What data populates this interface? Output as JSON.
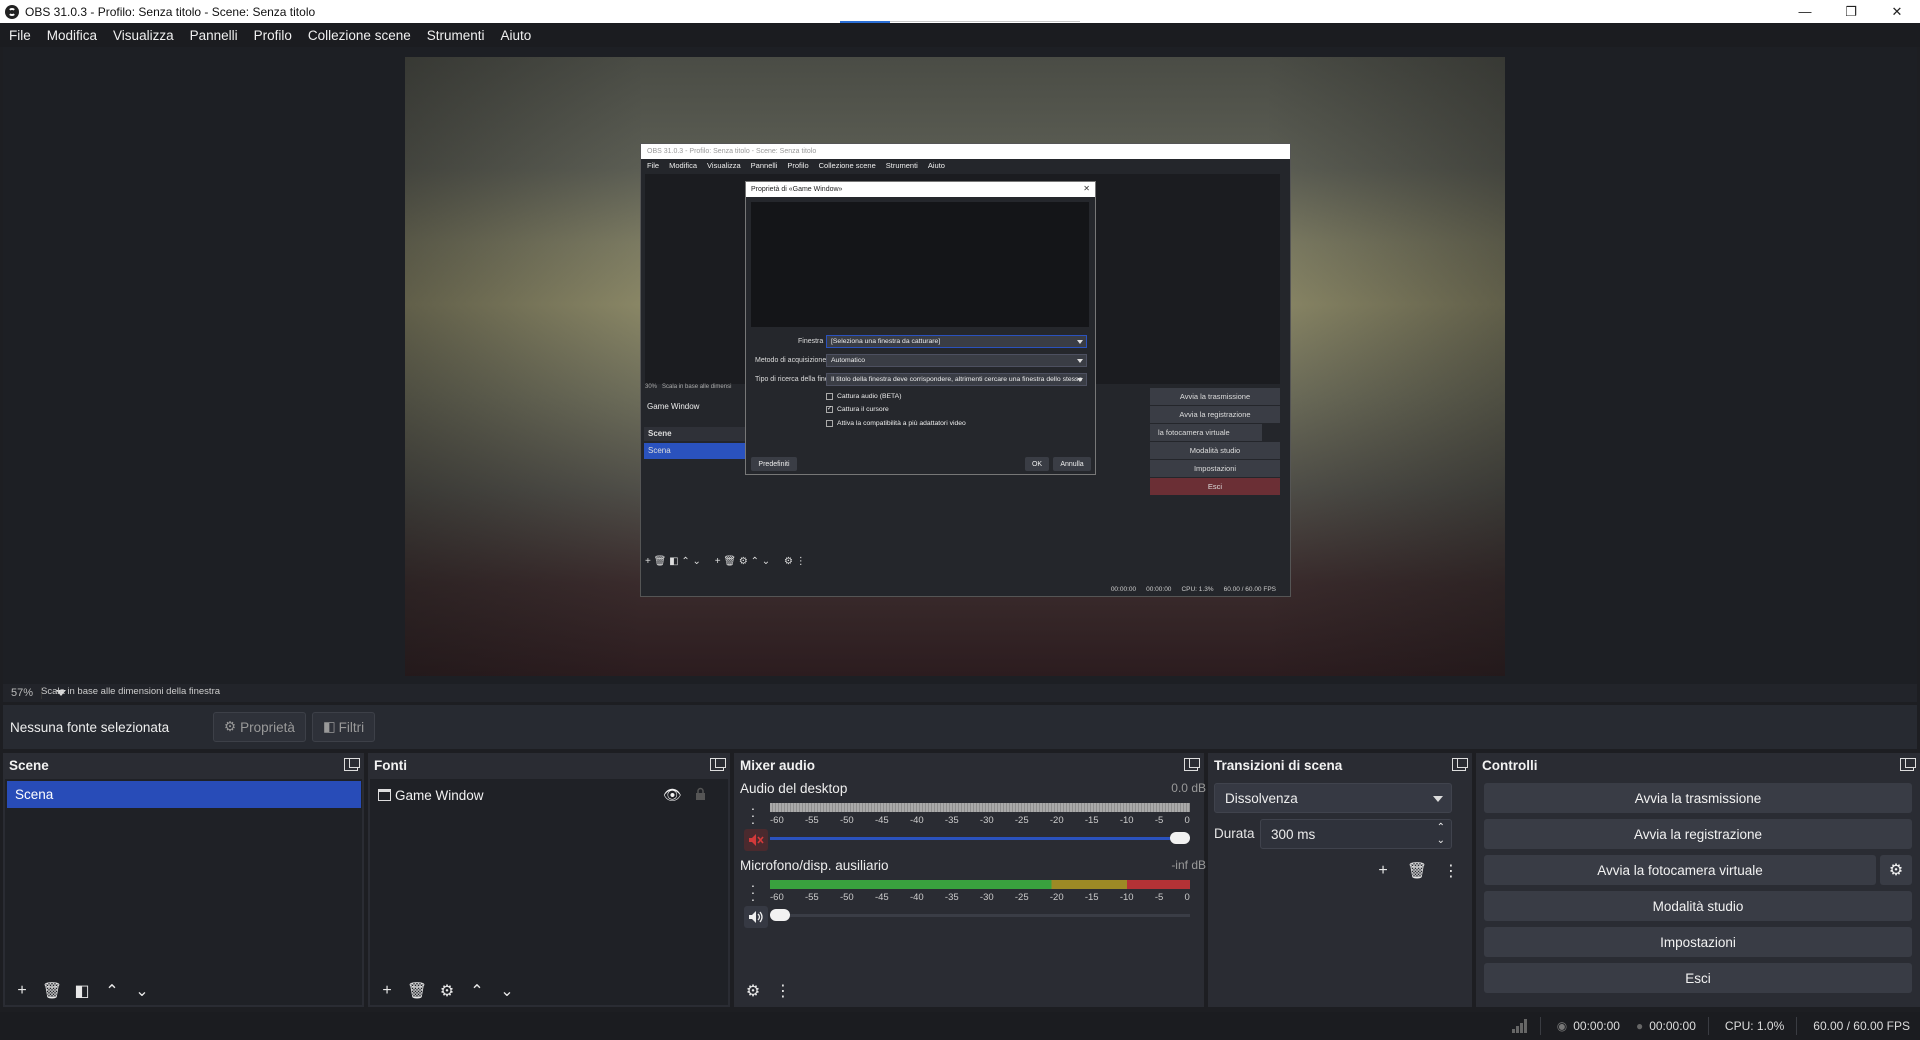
{
  "window": {
    "title": "OBS 31.0.3 - Profilo: Senza titolo - Scene: Senza titolo",
    "minimize": "—",
    "restore": "❐",
    "close": "✕"
  },
  "menu": [
    "File",
    "Modifica",
    "Visualizza",
    "Pannelli",
    "Profilo",
    "Collezione scene",
    "Strumenti",
    "Aiuto"
  ],
  "preview": {
    "zoom": "57%",
    "scale_mode": "Scala in base alle dimensioni della finestra",
    "nested": {
      "title": "OBS 31.0.3 - Profilo: Senza titolo - Scene: Senza titolo",
      "menu": [
        "File",
        "Modifica",
        "Visualizza",
        "Pannelli",
        "Profilo",
        "Collezione scene",
        "Strumenti",
        "Aiuto"
      ],
      "status_zoom": "30%",
      "status_scale": "Scala in base alle dimensi",
      "game_window": "Game Window",
      "scene_header": "Scene",
      "scene_item": "Scena",
      "controls": [
        "Avvia la trasmissione",
        "Avvia la registrazione",
        "la fotocamera virtuale",
        "Modalità studio",
        "Impostazioni",
        "Esci"
      ],
      "footer": [
        "00:00:00",
        "00:00:00",
        "CPU: 1.3%",
        "60.00 / 60.00 FPS"
      ],
      "dialog": {
        "title": "Proprietà di «Game Window»",
        "window_label": "Finestra",
        "window_value": "[Seleziona una finestra da catturare]",
        "method_label": "Metodo di acquisizione",
        "method_value": "Automatico",
        "match_label": "Tipo di ricerca della fine",
        "match_value": "Il titolo della finestra deve corrispondere, altrimenti cercare una finestra dello stesso",
        "check_audio": "Cattura audio (BETA)",
        "check_cursor": "Cattura il cursore",
        "check_multi": "Attiva la compatibilità a più adattatori video",
        "defaults_btn": "Predefiniti",
        "ok_btn": "OK",
        "cancel_btn": "Annulla"
      }
    }
  },
  "source_bar": {
    "no_source": "Nessuna fonte selezionata",
    "properties": "Proprietà",
    "filters": "Filtri"
  },
  "scenes": {
    "title": "Scene",
    "items": [
      "Scena"
    ]
  },
  "sources": {
    "title": "Fonti",
    "items": [
      "Game Window"
    ]
  },
  "mixer": {
    "title": "Mixer audio",
    "channels": [
      {
        "name": "Audio del desktop",
        "db": "0.0 dB",
        "muted": true,
        "volume": 1.0
      },
      {
        "name": "Microfono/disp. ausiliario",
        "db": "-inf dB",
        "muted": false,
        "volume": 0.0
      }
    ],
    "scale": [
      "-60",
      "-55",
      "-50",
      "-45",
      "-40",
      "-35",
      "-30",
      "-25",
      "-20",
      "-15",
      "-10",
      "-5",
      "0"
    ]
  },
  "transitions": {
    "title": "Transizioni di scena",
    "selected": "Dissolvenza",
    "duration_label": "Durata",
    "duration_value": "300 ms"
  },
  "controls": {
    "title": "Controlli",
    "start_stream": "Avvia la trasmissione",
    "start_record": "Avvia la registrazione",
    "virtual_cam": "Avvia la fotocamera virtuale",
    "studio_mode": "Modalità studio",
    "settings": "Impostazioni",
    "exit": "Esci"
  },
  "status": {
    "stream_time": "00:00:00",
    "record_time": "00:00:00",
    "cpu": "CPU: 1.0%",
    "fps": "60.00 / 60.00 FPS"
  },
  "colors": {
    "accent": "#284cb8",
    "meter_green": "#39a13e",
    "meter_yellow": "#9d8a25",
    "meter_red": "#b33236",
    "mute_red": "#d23a3a"
  }
}
